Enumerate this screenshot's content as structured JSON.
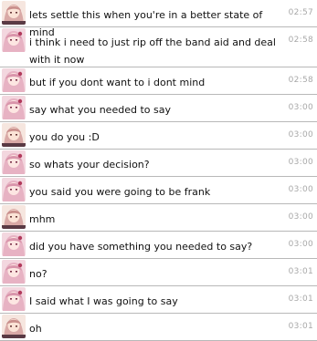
{
  "messages": [
    {
      "text": "lets settle this when you're in a better state of mind",
      "time": "02:57",
      "avatar": "user-b-avatar"
    },
    {
      "text": "i think i need to just rip off the band aid and deal with it now",
      "time": "02:58",
      "avatar": "user-a-avatar"
    },
    {
      "text": "but if you dont want to i dont mind",
      "time": "02:58",
      "avatar": "user-a-avatar"
    },
    {
      "text": "say what you needed to say",
      "time": "03:00",
      "avatar": "user-a-avatar"
    },
    {
      "text": "you do you :D",
      "time": "03:00",
      "avatar": "user-b-avatar"
    },
    {
      "text": "so whats your decision?",
      "time": "03:00",
      "avatar": "user-a-avatar"
    },
    {
      "text": "you said you were going to be frank",
      "time": "03:00",
      "avatar": "user-a-avatar"
    },
    {
      "text": "mhm",
      "time": "03:00",
      "avatar": "user-b-avatar"
    },
    {
      "text": "did you have something you needed to say?",
      "time": "03:00",
      "avatar": "user-a-avatar"
    },
    {
      "text": "no?",
      "time": "03:01",
      "avatar": "user-a-avatar"
    },
    {
      "text": "I said what I was going to say",
      "time": "03:01",
      "avatar": "user-a-avatar"
    },
    {
      "text": "oh",
      "time": "03:01",
      "avatar": "user-b-avatar"
    }
  ],
  "colors": {
    "separator": "#b8b8b8",
    "timestamp": "#a8a8a8",
    "text": "#111111"
  }
}
